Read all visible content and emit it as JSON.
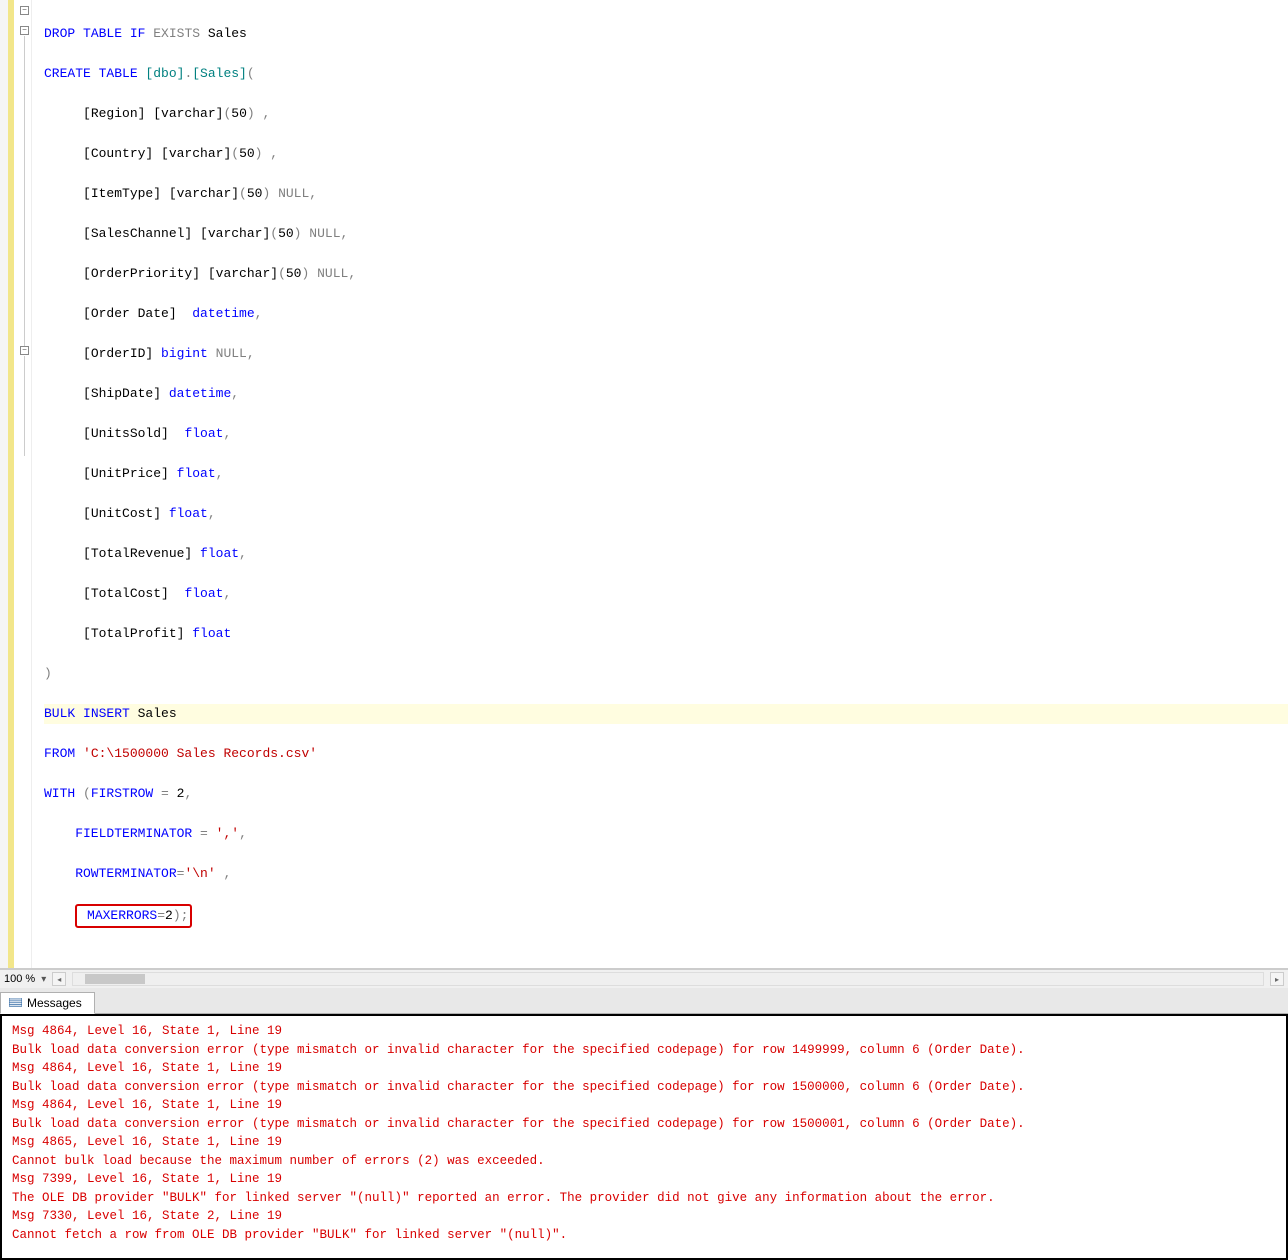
{
  "zoom": {
    "value": "100 %"
  },
  "tabs": {
    "messages": "Messages"
  },
  "code": {
    "l01a": "DROP",
    "l01b": " TABLE",
    "l01c": " IF",
    "l01d": " EXISTS",
    "l01e": " Sales",
    "l02a": "CREATE",
    "l02b": " TABLE",
    "l02c": " [dbo]",
    "l02d": ".",
    "l02e": "[Sales]",
    "l02f": "(",
    "ind": "     ",
    "l03a": "[Region] [varchar]",
    "l03b": "(",
    "l03c": "50",
    "l03d": ") ",
    "l03e": ",",
    "l04a": "[Country] [varchar]",
    "l04b": "(",
    "l04c": "50",
    "l04d": ") ",
    "l04e": ",",
    "l05a": "[ItemType] [varchar]",
    "l05b": "(",
    "l05c": "50",
    "l05d": ")",
    "l05e": " NULL",
    "l05f": ",",
    "l06a": "[SalesChannel] [varchar]",
    "l06b": "(",
    "l06c": "50",
    "l06d": ")",
    "l06e": " NULL",
    "l06f": ",",
    "l07a": "[OrderPriority] [varchar]",
    "l07b": "(",
    "l07c": "50",
    "l07d": ")",
    "l07e": " NULL",
    "l07f": ",",
    "l08a": "[Order Date] ",
    "l08b": " datetime",
    "l08c": ",",
    "l09a": "[OrderID]",
    "l09b": " bigint",
    "l09c": " NULL",
    "l09d": ",",
    "l10a": "[ShipDate]",
    "l10b": " datetime",
    "l10c": ",",
    "l11a": "[UnitsSold] ",
    "l11b": " float",
    "l11c": ",",
    "l12a": "[UnitPrice]",
    "l12b": " float",
    "l12c": ",",
    "l13a": "[UnitCost]",
    "l13b": " float",
    "l13c": ",",
    "l14a": "[TotalRevenue]",
    "l14b": " float",
    "l14c": ",",
    "l15a": "[TotalCost] ",
    "l15b": " float",
    "l15c": ",",
    "l16a": "[TotalProfit]",
    "l16b": " float",
    "l17a": ")",
    "l18a": "BULK",
    "l18b": " INSERT",
    "l18c": " Sales",
    "l19a": "FROM",
    "l19b": " 'C:\\1500000 Sales Records.csv'",
    "l20a": "WITH",
    "l20b": " (",
    "l20c": "FIRSTROW",
    "l20d": " =",
    "l20e": " 2",
    "l20f": ",",
    "l21a": "    FIELDTERMINATOR",
    "l21b": " =",
    "l21c": " ','",
    "l21d": ",",
    "l22a": "    ROWTERMINATOR",
    "l22b": "=",
    "l22c": "'\\n'",
    "l22d": " ",
    "l22e": ",",
    "maxerr_ind": "    ",
    "l23a": " MAXERRORS",
    "l23b": "=",
    "l23c": "2",
    "l23d": ")",
    "l23e": ";"
  },
  "messages": {
    "m1": "Msg 4864, Level 16, State 1, Line 19",
    "m2": "Bulk load data conversion error (type mismatch or invalid character for the specified codepage) for row 1499999, column 6 (Order Date).",
    "m3": "Msg 4864, Level 16, State 1, Line 19",
    "m4": "Bulk load data conversion error (type mismatch or invalid character for the specified codepage) for row 1500000, column 6 (Order Date).",
    "m5": "Msg 4864, Level 16, State 1, Line 19",
    "m6": "Bulk load data conversion error (type mismatch or invalid character for the specified codepage) for row 1500001, column 6 (Order Date).",
    "m7": "Msg 4865, Level 16, State 1, Line 19",
    "m8": "Cannot bulk load because the maximum number of errors (2) was exceeded.",
    "m9": "Msg 7399, Level 16, State 1, Line 19",
    "m10": "The OLE DB provider \"BULK\" for linked server \"(null)\" reported an error. The provider did not give any information about the error.",
    "m11": "Msg 7330, Level 16, State 2, Line 19",
    "m12": "Cannot fetch a row from OLE DB provider \"BULK\" for linked server \"(null)\"."
  }
}
